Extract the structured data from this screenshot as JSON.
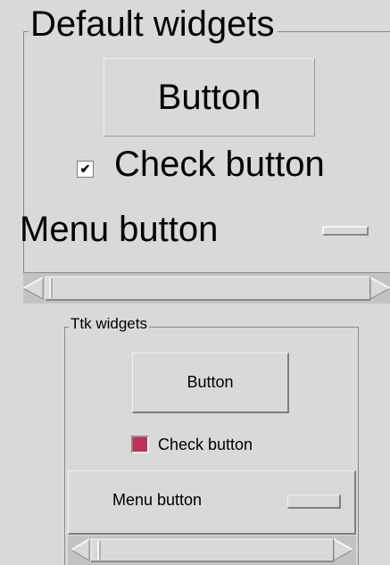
{
  "default_frame": {
    "legend": "Default widgets",
    "button_label": "Button",
    "check_mark": "✔",
    "check_label": "Check button",
    "menubutton_label": "Menu button"
  },
  "ttk_frame": {
    "legend": "Ttk widgets",
    "button_label": "Button",
    "check_label": "Check button",
    "menubutton_label": "Menu button"
  },
  "colors": {
    "background": "#d9d9d9",
    "trough": "#c3c3c3",
    "ttk_check_indicator": "#c0305a"
  },
  "icons": {
    "scroll_left": "left-arrow-icon",
    "scroll_right": "right-arrow-icon"
  }
}
